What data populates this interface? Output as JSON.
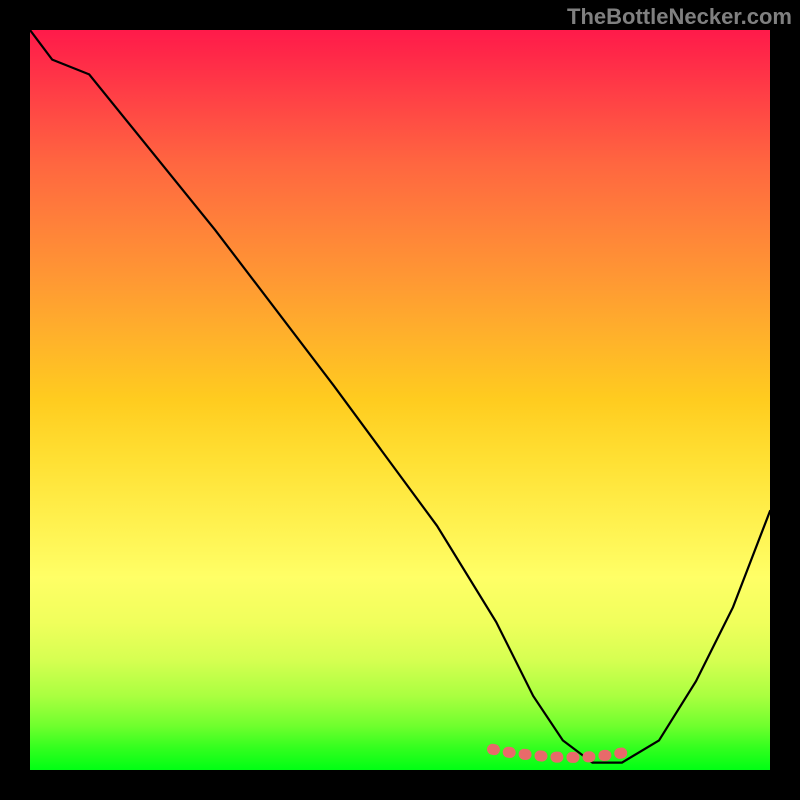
{
  "watermark": "TheBottleNecker.com",
  "chart_data": {
    "type": "line",
    "title": "",
    "xlabel": "",
    "ylabel": "",
    "ylim": [
      0,
      100
    ],
    "xlim": [
      0,
      100
    ],
    "series": [
      {
        "name": "curve",
        "x": [
          0,
          3,
          8,
          25,
          41,
          55,
          63,
          68,
          72,
          76,
          80,
          85,
          90,
          95,
          100
        ],
        "values": [
          100,
          96,
          94,
          73,
          52,
          33,
          20,
          10,
          4,
          1,
          1,
          4,
          12,
          22,
          35
        ]
      },
      {
        "name": "highlight",
        "x": [
          62.5,
          64,
          66,
          68,
          70,
          72,
          74,
          76,
          78,
          80,
          81.5
        ],
        "values": [
          2.8,
          2.5,
          2.2,
          2.0,
          1.8,
          1.7,
          1.7,
          1.8,
          2.0,
          2.3,
          2.6
        ]
      }
    ],
    "gradient_stops": [
      {
        "pct": 0,
        "color": "#ff1a4a"
      },
      {
        "pct": 25,
        "color": "#ff803a"
      },
      {
        "pct": 50,
        "color": "#ffcc1f"
      },
      {
        "pct": 80,
        "color": "#f0ff5c"
      },
      {
        "pct": 100,
        "color": "#00ff14"
      }
    ],
    "frame_color": "#000000",
    "frame_thickness_px": 30
  }
}
